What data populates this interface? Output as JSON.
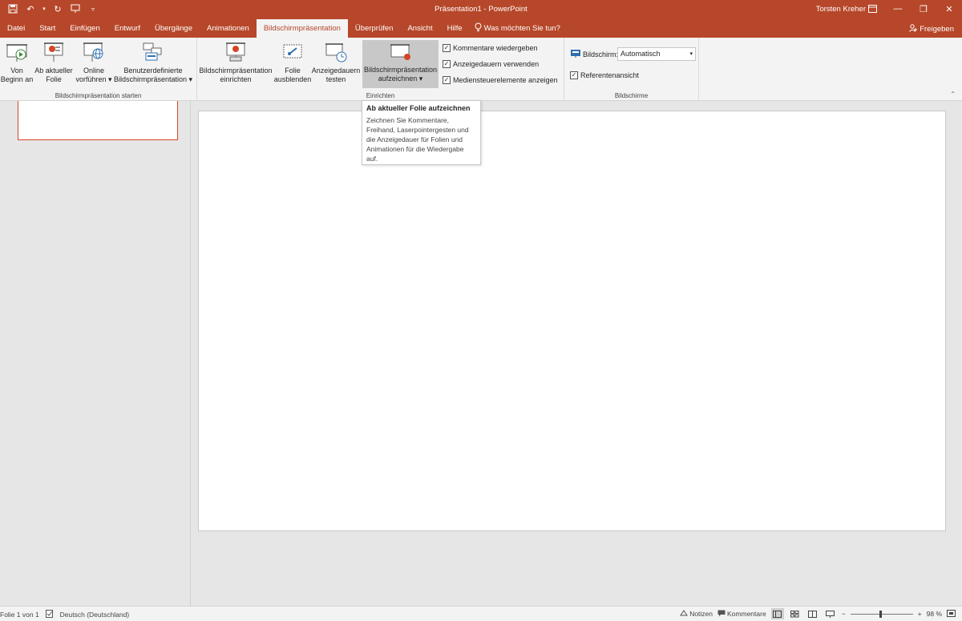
{
  "titlebar": {
    "title": "Präsentation1  -  PowerPoint",
    "user": "Torsten Kreher",
    "bg_color": "#b7472a"
  },
  "tabs": [
    {
      "label": "Datei"
    },
    {
      "label": "Start"
    },
    {
      "label": "Einfügen"
    },
    {
      "label": "Entwurf"
    },
    {
      "label": "Übergänge"
    },
    {
      "label": "Animationen"
    },
    {
      "label": "Bildschirmpräsentation",
      "active": true
    },
    {
      "label": "Überprüfen"
    },
    {
      "label": "Ansicht"
    },
    {
      "label": "Hilfe"
    }
  ],
  "tellme": "Was möchten Sie tun?",
  "share": "Freigeben",
  "ribbon": {
    "group_start": {
      "label": "Bildschirmpräsentation starten",
      "von_beginn": [
        "Von",
        "Beginn an"
      ],
      "ab_aktueller": [
        "Ab aktueller",
        "Folie"
      ],
      "online": [
        "Online",
        "vorführen ▾"
      ],
      "benutzer": [
        "Benutzerdefinierte",
        "Bildschirmpräsentation ▾"
      ]
    },
    "group_einrichten": {
      "label": "Einrichten",
      "einrichten": [
        "Bildschirmpräsentation",
        "einrichten"
      ],
      "ausblenden": [
        "Folie",
        "ausblenden"
      ],
      "testen": [
        "Anzeigedauern",
        "testen"
      ],
      "aufzeichnen": [
        "Bildschirmpräsentation",
        "aufzeichnen ▾"
      ],
      "chk_kommentare": "Kommentare wiedergeben",
      "chk_anzeigedauern": "Anzeigedauern verwenden",
      "chk_mediensteuer": "Mediensteuerelemente anzeigen"
    },
    "group_bildschirme": {
      "label": "Bildschirme",
      "bildschirm_label": "Bildschirm:",
      "bildschirm_value": "Automatisch",
      "referentenansicht": "Referentenansicht"
    }
  },
  "tooltip": {
    "title": "Ab aktueller Folie aufzeichnen",
    "body": "Zeichnen Sie Kommentare, Freihand, Laserpointergesten und die Anzeigedauer für Folien und Animationen für die Wiedergabe auf."
  },
  "statusbar": {
    "slide_info": "Folie 1 von 1",
    "language": "Deutsch (Deutschland)",
    "notes": "Notizen",
    "comments": "Kommentare",
    "zoom": "98 %",
    "zoom_percent": 98
  }
}
